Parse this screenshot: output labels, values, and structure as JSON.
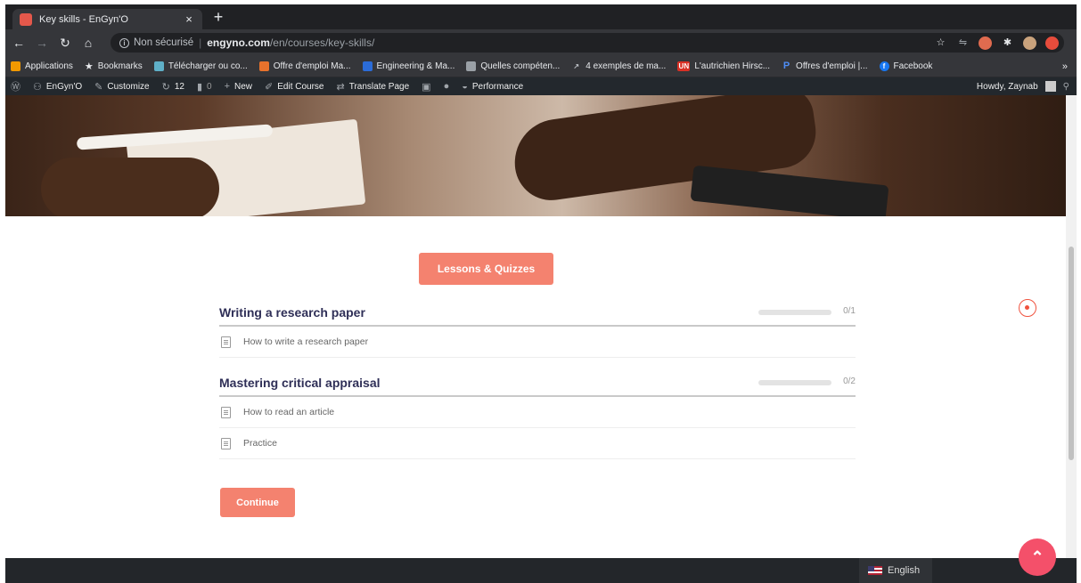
{
  "browser": {
    "tab_title": "Key skills - EnGyn'O",
    "tab_close": "×",
    "new_tab": "+",
    "security_label": "Non sécurisé",
    "url_separator": "|",
    "url_host": "engyno.com",
    "url_path": "/en/courses/key-skills/"
  },
  "bookmarks": {
    "items": [
      {
        "label": "Applications",
        "icon": "apps-grid-icon",
        "color": "#f29900"
      },
      {
        "label": "Bookmarks",
        "icon": "star-icon",
        "color": "#e8eaed"
      },
      {
        "label": "Télécharger ou co...",
        "icon": "download-icon",
        "color": "#5fb0c8"
      },
      {
        "label": "Offre d'emploi Ma...",
        "icon": "job-icon",
        "color": "#e8722c"
      },
      {
        "label": "Engineering & Ma...",
        "icon": "engineering-icon",
        "color": "#2b6cd8"
      },
      {
        "label": "Quelles compéten...",
        "icon": "skills-icon",
        "color": "#9aa0a6"
      },
      {
        "label": "4 exemples de ma...",
        "icon": "trend-icon",
        "color": "#9aa0a6"
      },
      {
        "label": "L'autrichien Hirsc...",
        "icon": "un-icon",
        "color": "#d93025"
      },
      {
        "label": "Offres d'emploi |...",
        "icon": "p-icon",
        "color": "#1a73e8"
      },
      {
        "label": "Facebook",
        "icon": "facebook-icon",
        "color": "#1877f2"
      }
    ],
    "more": "»"
  },
  "adminbar": {
    "site_name": "EnGyn'O",
    "customize": "Customize",
    "updates": "12",
    "comments": "0",
    "new": "New",
    "edit_course": "Edit Course",
    "translate_page": "Translate Page",
    "performance": "Performance",
    "howdy": "Howdy, Zaynab"
  },
  "content": {
    "tab_button": "Lessons & Quizzes",
    "sections": [
      {
        "title": "Writing a research paper",
        "progress_text": "0/1",
        "progress": 0,
        "lessons": [
          "How to write a research paper"
        ]
      },
      {
        "title": "Mastering critical appraisal",
        "progress_text": "0/2",
        "progress": 0,
        "lessons": [
          "How to read an article",
          "Practice"
        ]
      }
    ],
    "continue": "Continue"
  },
  "footer": {
    "language": "English"
  },
  "colors": {
    "accent": "#f4826f",
    "heading": "#2f2f57",
    "footer": "#23262a"
  }
}
